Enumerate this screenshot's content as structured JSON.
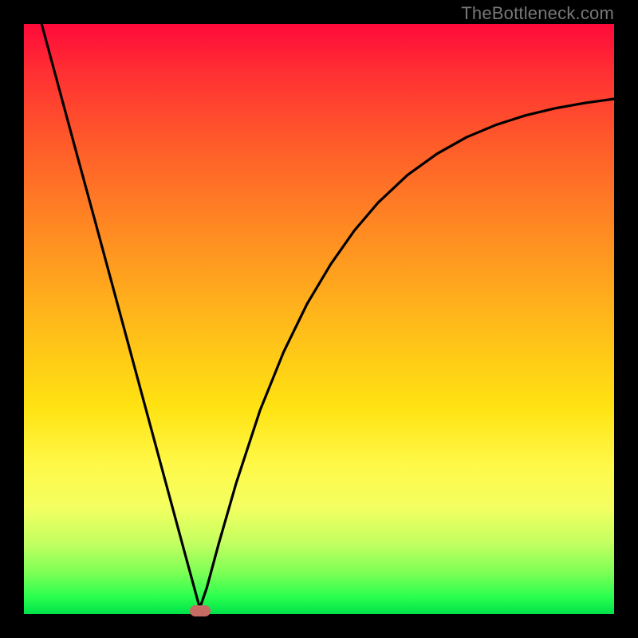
{
  "watermark": "TheBottleneck.com",
  "colors": {
    "frame": "#000000",
    "curve": "#000000",
    "marker": "#c76a64",
    "gradient_top": "#ff0a3a",
    "gradient_bottom": "#00e24a"
  },
  "chart_data": {
    "type": "line",
    "title": "",
    "xlabel": "",
    "ylabel": "",
    "xlim": [
      0,
      1
    ],
    "ylim": [
      0,
      1
    ],
    "series": [
      {
        "name": "curve",
        "x": [
          0.03,
          0.06,
          0.09,
          0.12,
          0.15,
          0.18,
          0.21,
          0.24,
          0.27,
          0.298,
          0.31,
          0.33,
          0.36,
          0.4,
          0.44,
          0.48,
          0.52,
          0.56,
          0.6,
          0.65,
          0.7,
          0.75,
          0.8,
          0.85,
          0.9,
          0.95,
          1.0
        ],
        "y": [
          1.0,
          0.889,
          0.778,
          0.668,
          0.557,
          0.446,
          0.335,
          0.224,
          0.113,
          0.01,
          0.045,
          0.119,
          0.223,
          0.345,
          0.444,
          0.526,
          0.593,
          0.65,
          0.697,
          0.744,
          0.78,
          0.808,
          0.829,
          0.845,
          0.857,
          0.866,
          0.873
        ]
      }
    ],
    "annotations": [
      {
        "name": "min-marker",
        "x": 0.298,
        "y": 0.005
      }
    ]
  }
}
